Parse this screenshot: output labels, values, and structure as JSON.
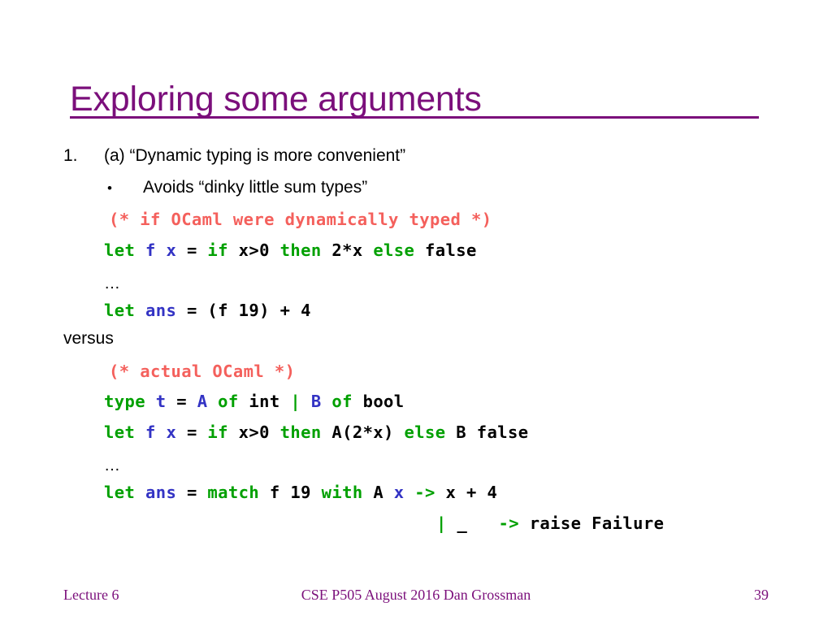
{
  "slide": {
    "title": "Exploring some arguments",
    "accent_color": "#7B0F7B",
    "background_color": "#FFFFFF"
  },
  "body": {
    "numbered_item": {
      "number": "1.",
      "text": "(a) “Dynamic typing is more convenient”"
    },
    "sub_bullet": {
      "marker": "•",
      "text": "Avoids “dinky little sum types”"
    },
    "separator_text": "versus",
    "ellipsis": "…"
  },
  "code_colors": {
    "keyword": "#00A000",
    "identifier": "#3333C4",
    "comment": "#F4605C",
    "plain": "#000000"
  },
  "code_block_1": {
    "comment": "(* if OCaml were dynamically typed *)",
    "line_let_f": {
      "t1": "let ",
      "t2": "f x ",
      "t3": "= ",
      "t4": "if ",
      "t5": "x>0 ",
      "t6": "then ",
      "t7": "2*x ",
      "t8": "else ",
      "t9": "false"
    },
    "line_let_ans": {
      "t1": "let ",
      "t2": "ans ",
      "t3": "= (f 19) + 4"
    }
  },
  "code_block_2": {
    "comment": "(* actual OCaml *)",
    "line_type": {
      "t1": "type ",
      "t2": "t ",
      "t3": "= ",
      "t4": "A ",
      "t5": "of ",
      "t6": "int ",
      "t7": "| ",
      "t8": "B ",
      "t9": "of ",
      "t10": "bool"
    },
    "line_let_f": {
      "t1": "let ",
      "t2": "f x ",
      "t3": "= ",
      "t4": "if ",
      "t5": "x>0 ",
      "t6": "then ",
      "t7": "A(2*x) ",
      "t8": "else ",
      "t9": "B false"
    },
    "line_let_ans": {
      "t1": "let ",
      "t2": "ans ",
      "t3": "= ",
      "t4": "match ",
      "t5": "f 19 ",
      "t6": "with ",
      "t7": "A ",
      "t8": "x ",
      "t9": "-> ",
      "t10": "x + 4"
    },
    "line_fallthrough": {
      "t1": "| ",
      "t2": "_   ",
      "t3": "-> ",
      "t4": "raise Failure"
    }
  },
  "footer": {
    "left": "Lecture 6",
    "center": "CSE P505 August 2016  Dan Grossman",
    "page_number": "39"
  }
}
